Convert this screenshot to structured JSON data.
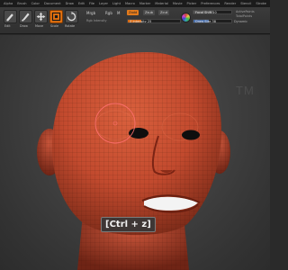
{
  "menu": {
    "items": [
      "Alpha",
      "Brush",
      "Color",
      "Document",
      "Draw",
      "Edit",
      "File",
      "Layer",
      "Light",
      "Macro",
      "Marker",
      "Material",
      "Movie",
      "Picker",
      "Preferences",
      "Render",
      "Stencil",
      "Stroke",
      "Texture",
      "Tool",
      "Transform",
      "Zplugin",
      "Zscript"
    ]
  },
  "toolbar": {
    "tools": [
      {
        "label": "Edit",
        "icon": "edit-pen-icon"
      },
      {
        "label": "Draw",
        "icon": "draw-pencil-icon"
      },
      {
        "label": "Move",
        "icon": "move-arrows-icon"
      },
      {
        "label": "Scale",
        "icon": "scale-box-icon"
      },
      {
        "label": "Rotate",
        "icon": "rotate-arrow-icon"
      }
    ],
    "mrgb_label": "Mrgb",
    "rgb_label": "Rgb",
    "m_label": "M",
    "zadd_label": "Zadd",
    "zsub_label": "Zsub",
    "zcut_label": "Zcut",
    "rgb_intensity_label": "Rgb Intensity",
    "z_intensity_label": "Z Intensity 25",
    "z_intensity_value": 0.25,
    "focal_shift_label": "Focal Shift 10",
    "draw_size_label": "Draw Size 38",
    "dynamic_label": "Dynamic",
    "active_points_label": "ActivePoints",
    "total_points_label": "TotalPoints"
  },
  "colors": {
    "accent": "#e8730f",
    "head_skin": "#c24a2e"
  },
  "viewport": {
    "watermark": "TM",
    "shortcut_hint": "[Ctrl + z]"
  }
}
